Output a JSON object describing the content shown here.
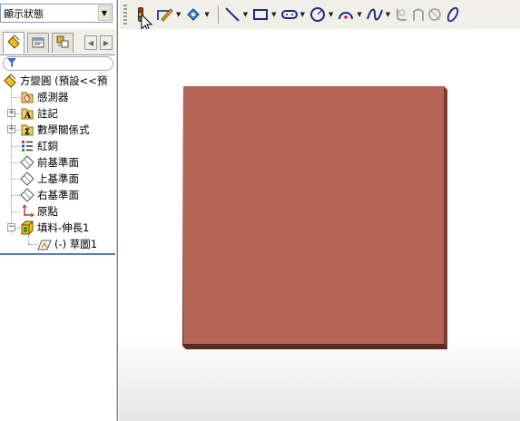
{
  "display_state_combo": {
    "value": "顯示狀態"
  },
  "toolbar": {
    "items": [
      "smart-dimension-icon",
      "sketch-icon",
      "draw-pen-icon",
      "line-icon",
      "rectangle-icon",
      "slot-icon",
      "circle-icon",
      "arc-icon",
      "spline-icon",
      "fillet-icon",
      "chamfer-icon",
      "offset-icon",
      "ellipse-icon"
    ]
  },
  "tree": {
    "root": "方變圓 (預設<<預",
    "items": [
      {
        "label": "感測器",
        "icon": "sensor-icon",
        "expandable": false
      },
      {
        "label": "註記",
        "icon": "annotation-icon",
        "expandable": true
      },
      {
        "label": "數學關係式",
        "icon": "equation-icon",
        "expandable": true
      },
      {
        "label": "紅銅",
        "icon": "material-icon",
        "expandable": false
      },
      {
        "label": "前基準面",
        "icon": "plane-icon",
        "expandable": false
      },
      {
        "label": "上基準面",
        "icon": "plane-icon",
        "expandable": false
      },
      {
        "label": "右基準面",
        "icon": "plane-icon",
        "expandable": false
      },
      {
        "label": "原點",
        "icon": "origin-icon",
        "expandable": false
      },
      {
        "label": "填料-伸長1",
        "icon": "extrude-icon",
        "expandable": true,
        "expanded": true
      },
      {
        "label": "(-) 草圖1",
        "icon": "sketch-node-icon",
        "expandable": false,
        "child": true
      }
    ]
  },
  "colors": {
    "part_face": "#b56555",
    "part_edge": "#4a2418",
    "selection_bar": "#5a7fb5"
  }
}
